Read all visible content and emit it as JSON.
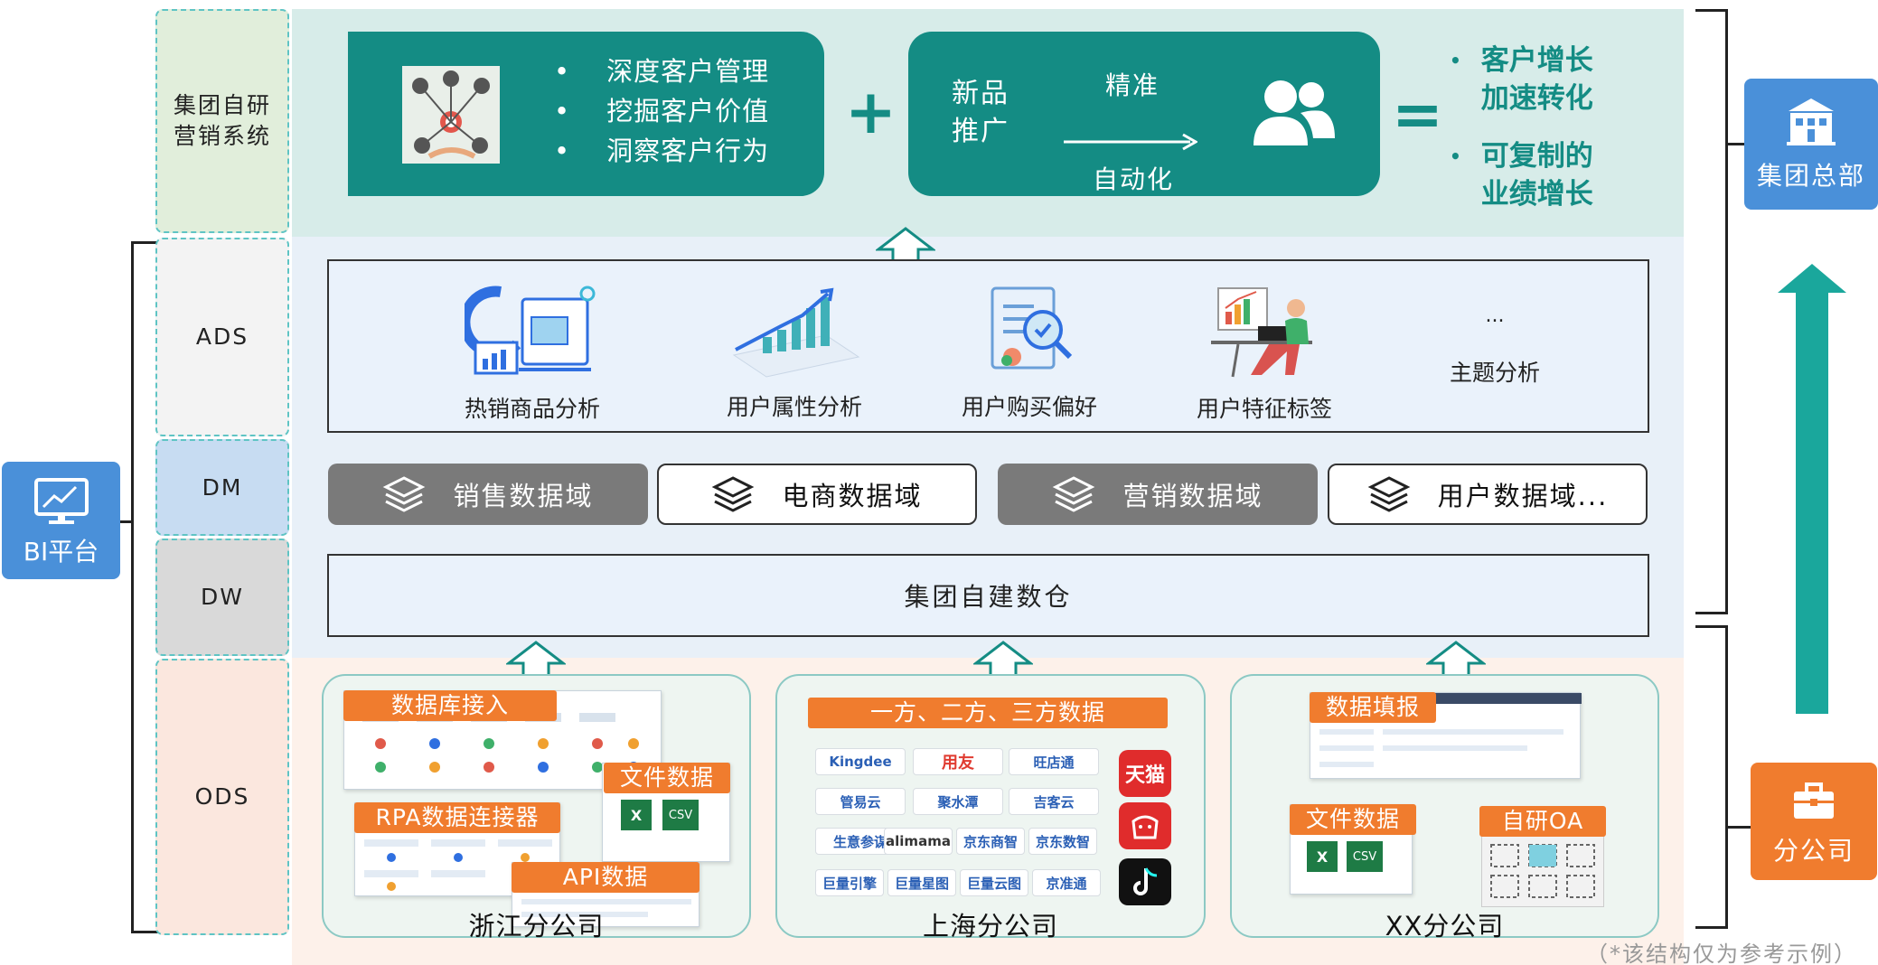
{
  "left": {
    "bi_platform": "BI平台"
  },
  "layers": {
    "marketing_system": "集团自研\n营销系统",
    "ads": "ADS",
    "dm": "DM",
    "dw": "DW",
    "ods": "ODS"
  },
  "top": {
    "bullets": [
      "深度客户管理",
      "挖掘客户价值",
      "洞察客户行为"
    ],
    "plus": "+",
    "new_product": "新品\n推广",
    "arrow_top": "精准",
    "arrow_bottom": "自动化",
    "equals": "=",
    "results": [
      "客户增长\n加速转化",
      "可复制的\n业绩增长"
    ]
  },
  "ads": {
    "items": [
      "热销商品分析",
      "用户属性分析",
      "用户购买偏好",
      "用户特征标签",
      "主题分析"
    ],
    "ellipsis": "..."
  },
  "domains": [
    "销售数据域",
    "电商数据域",
    "营销数据域",
    "用户数据域..."
  ],
  "dw": {
    "label": "集团自建数仓"
  },
  "branches": [
    {
      "name": "浙江分公司",
      "tags": [
        "数据库接入",
        "文件数据",
        "RPA数据连接器",
        "API数据"
      ]
    },
    {
      "name": "上海分公司",
      "tags": [
        "一方、二方、三方数据"
      ],
      "logos": [
        "Kingdee",
        "用友",
        "旺店通",
        "管易云",
        "聚水潭",
        "吉客云",
        "生意参谋",
        "alimama",
        "京东商智",
        "京东数智",
        "巨量引擎",
        "巨量星图",
        "巨量云图",
        "京准通"
      ],
      "apps": [
        "天猫",
        "拼多多",
        "抖音"
      ]
    },
    {
      "name": "XX分公司",
      "tags": [
        "数据填报",
        "文件数据",
        "自研OA"
      ]
    }
  ],
  "right": {
    "hq": "集团总部",
    "branch": "分公司"
  },
  "note": "（*该结构仅为参考示例）",
  "file_icons": {
    "csv": "CSV"
  },
  "colors": {
    "teal": "#148c84",
    "blue": "#4a90d9",
    "orange": "#f07c2e",
    "gray": "#7a7a7a"
  }
}
